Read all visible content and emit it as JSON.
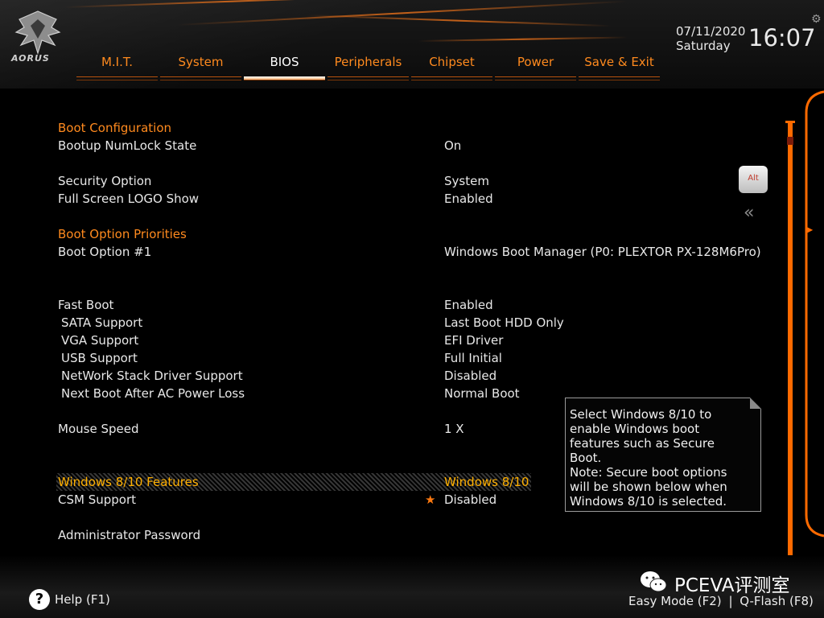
{
  "brand": {
    "logo_text": "AORUS"
  },
  "tabs": [
    {
      "label": "M.I.T.",
      "active": false
    },
    {
      "label": "System",
      "active": false
    },
    {
      "label": "BIOS",
      "active": true
    },
    {
      "label": "Peripherals",
      "active": false
    },
    {
      "label": "Chipset",
      "active": false
    },
    {
      "label": "Power",
      "active": false
    },
    {
      "label": "Save & Exit",
      "active": false
    }
  ],
  "datetime": {
    "date": "07/11/2020",
    "day": "Saturday",
    "time": "16:07"
  },
  "settings": {
    "boot_configuration": "Boot Configuration",
    "bootup_numlock": {
      "label": "Bootup NumLock State",
      "value": "On"
    },
    "security_option": {
      "label": "Security Option",
      "value": "System"
    },
    "full_screen_logo": {
      "label": "Full Screen LOGO Show",
      "value": "Enabled"
    },
    "boot_option_priorities": "Boot Option Priorities",
    "boot_option_1": {
      "label": "Boot Option #1",
      "value": "Windows Boot Manager (P0: PLEXTOR PX-128M6Pro)"
    },
    "fast_boot": {
      "label": "Fast Boot",
      "value": "Enabled"
    },
    "sata_support": {
      "label": "SATA Support",
      "value": "Last Boot HDD Only"
    },
    "vga_support": {
      "label": "VGA Support",
      "value": "EFI Driver"
    },
    "usb_support": {
      "label": "USB Support",
      "value": "Full Initial"
    },
    "network_stack": {
      "label": "NetWork Stack Driver Support",
      "value": "Disabled"
    },
    "next_boot_ac": {
      "label": "Next Boot After AC Power Loss",
      "value": "Normal Boot"
    },
    "mouse_speed": {
      "label": "Mouse Speed",
      "value": "1 X"
    },
    "windows_features": {
      "label": "Windows 8/10 Features",
      "value": "Windows 8/10"
    },
    "csm_support": {
      "label": "CSM Support",
      "value": "Disabled"
    },
    "admin_password": {
      "label": "Administrator Password"
    }
  },
  "help_box": {
    "lines": [
      "Select Windows 8/10 to",
      "enable Windows boot",
      "features such as Secure",
      "Boot.",
      "Note: Secure boot options",
      "will be shown below when",
      "Windows 8/10 is selected."
    ]
  },
  "side": {
    "alt_label": "Alt"
  },
  "footer": {
    "help_label": "Help (F1)",
    "easy_mode": "Easy Mode (F2)",
    "separator": "|",
    "qflash": "Q-Flash (F8)",
    "watermark": "PCEVA评测室"
  },
  "colors": {
    "accent": "#ff8a1e",
    "selected": "#ffb000",
    "scrollbar": "#ff6a00"
  }
}
